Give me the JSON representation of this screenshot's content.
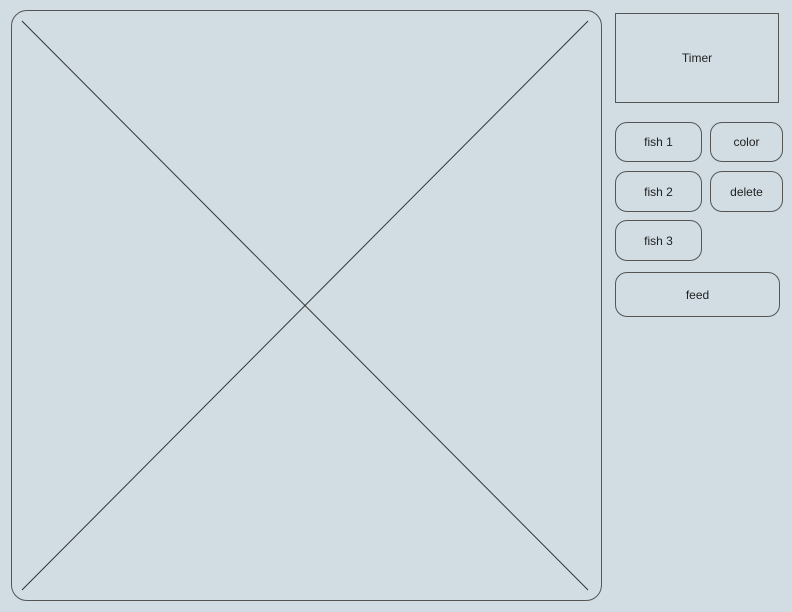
{
  "canvas": {
    "placeholder_icon": "image-placeholder-x-icon"
  },
  "timer": {
    "label": "Timer"
  },
  "controls": {
    "fish1_label": "fish 1",
    "fish2_label": "fish 2",
    "fish3_label": "fish 3",
    "color_label": "color",
    "delete_label": "delete",
    "feed_label": "feed"
  },
  "colors": {
    "background": "#d1dde3",
    "stroke": "#555555"
  }
}
